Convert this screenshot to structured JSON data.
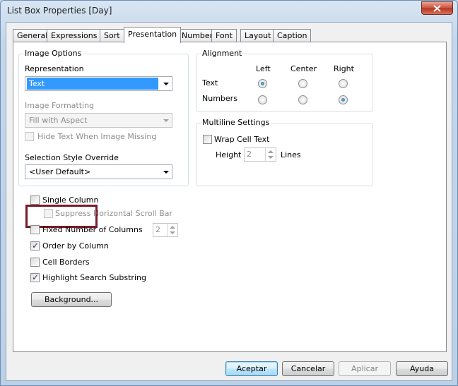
{
  "window": {
    "title": "List Box Properties [Day]"
  },
  "tabs": [
    {
      "label": "General"
    },
    {
      "label": "Expressions"
    },
    {
      "label": "Sort"
    },
    {
      "label": "Presentation"
    },
    {
      "label": "Number"
    },
    {
      "label": "Font"
    },
    {
      "label": "Layout"
    },
    {
      "label": "Caption"
    }
  ],
  "active_tab": "Presentation",
  "image_options": {
    "legend": "Image Options",
    "representation_label": "Representation",
    "representation_value": "Text",
    "image_formatting_label": "Image Formatting",
    "image_formatting_value": "Fill with Aspect",
    "hide_text_label": "Hide Text When Image Missing",
    "hide_text_checked": false,
    "selection_style_label": "Selection Style Override",
    "selection_style_value": "<User Default>"
  },
  "alignment": {
    "legend": "Alignment",
    "col_left": "Left",
    "col_center": "Center",
    "col_right": "Right",
    "row_text": "Text",
    "row_numbers": "Numbers",
    "text_selected": "Left",
    "numbers_selected": "Right"
  },
  "multiline": {
    "legend": "Multiline Settings",
    "wrap_label": "Wrap Cell Text",
    "wrap_checked": false,
    "height_label": "Height",
    "height_value": "2",
    "lines_label": "Lines"
  },
  "options": {
    "single_column": "Single Column",
    "single_column_checked": false,
    "suppress_scroll": "Suppress Horizontal Scroll Bar",
    "fixed_columns": "Fixed Number of Columns",
    "fixed_columns_checked": false,
    "fixed_columns_value": "2",
    "order_by_column": "Order by Column",
    "order_by_column_checked": true,
    "cell_borders": "Cell Borders",
    "cell_borders_checked": false,
    "highlight_search": "Highlight Search Substring",
    "highlight_search_checked": true,
    "background_button": "Background..."
  },
  "footer": {
    "accept": "Aceptar",
    "cancel": "Cancelar",
    "apply": "Aplicar",
    "help": "Ayuda"
  },
  "colors": {
    "highlight_box": "#7a1a2b",
    "selection_blue": "#3399ff",
    "close_button": "#c9503b"
  },
  "icons": {
    "close": "close-icon",
    "dropdown": "chevron-down-icon",
    "spin_up": "spin-up-icon",
    "spin_down": "spin-down-icon",
    "check": "check-icon"
  }
}
